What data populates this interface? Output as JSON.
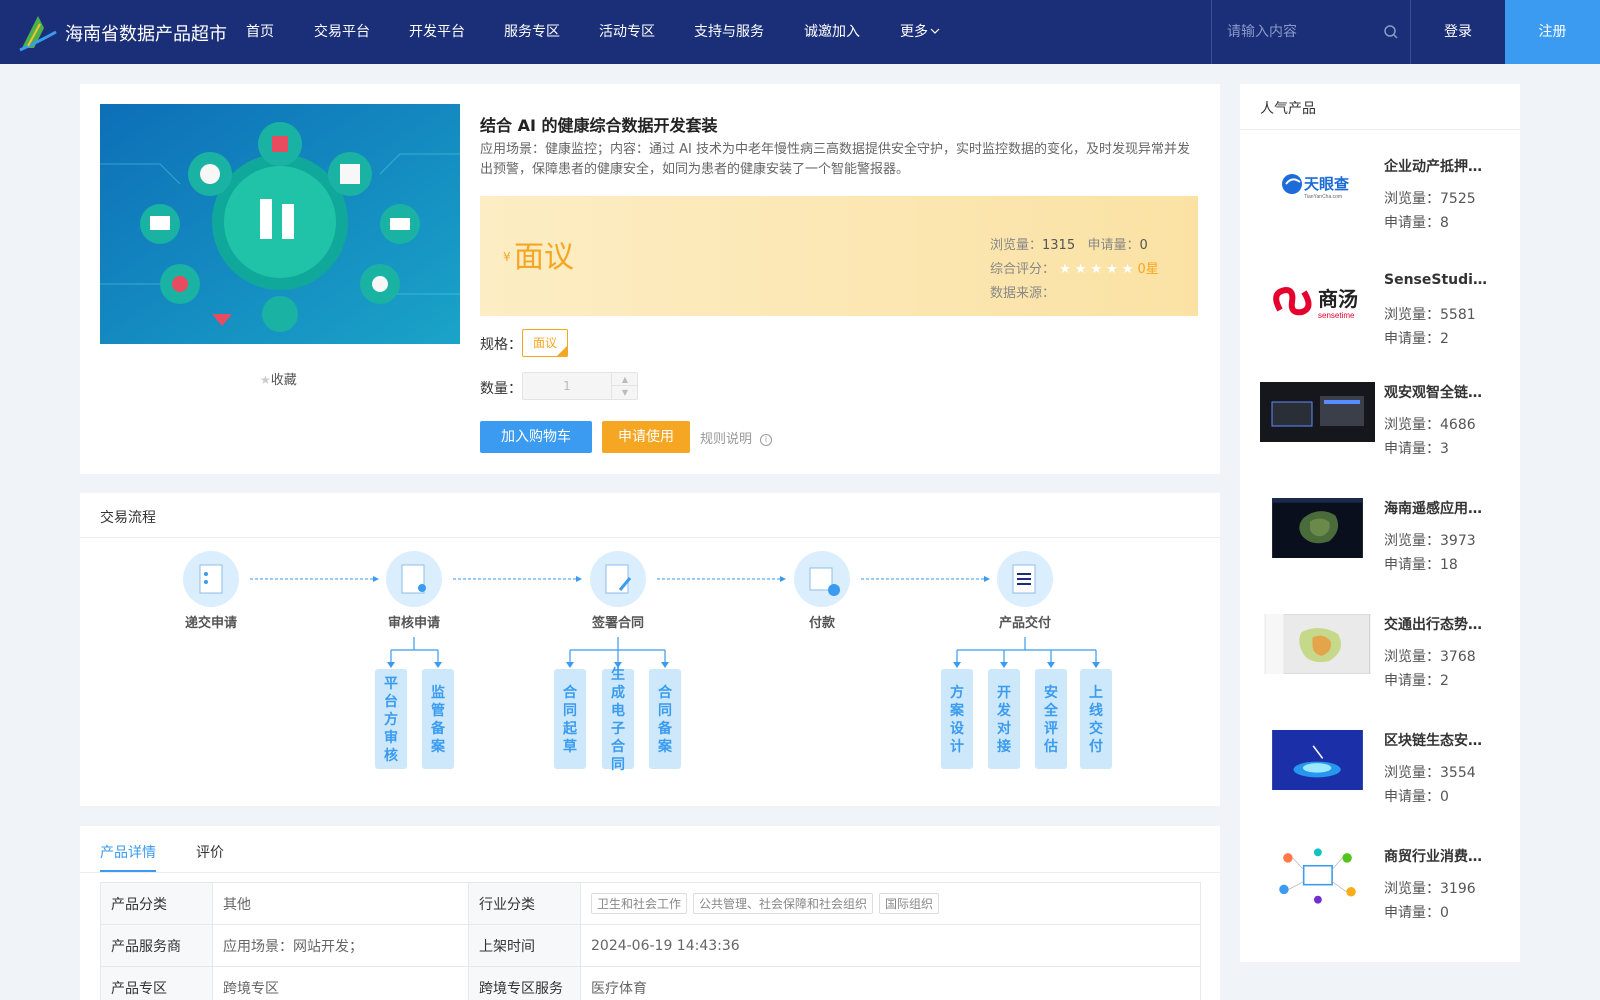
{
  "site": {
    "brand": "海南省数据产品超市",
    "nav": [
      "首页",
      "交易平台",
      "开发平台",
      "服务专区",
      "活动专区",
      "支持与服务",
      "诚邀加入",
      "更多"
    ],
    "search_placeholder": "请输入内容",
    "login": "登录",
    "register": "注册",
    "accent": "#3a9bf0",
    "header_bg": "#1b2f78",
    "price_color": "#f5a623"
  },
  "product": {
    "title": "结合 AI 的健康综合数据开发套装",
    "description": "应用场景：健康监控；内容：通过 AI 技术为中老年慢性病三高数据提供安全守护，实时监控数据的变化，及时发现异常并发出预警，保障患者的健康安全，如同为患者的健康安装了一个智能警报器。",
    "currency": "¥",
    "price": "面议",
    "views_label": "浏览量：",
    "views": "1315",
    "applications_label": "申请量：",
    "applications": "0",
    "rating_label": "综合评分：",
    "rating_stars": 0,
    "rating_text": "0星",
    "source_label": "数据来源：",
    "collect": "收藏",
    "spec_label": "规格：",
    "spec_value": "面议",
    "qty_label": "数量：",
    "qty_value": "1",
    "add_cart": "加入购物车",
    "apply": "申请使用",
    "rules": "规则说明"
  },
  "flow": {
    "title": "交易流程",
    "steps": [
      "递交申请",
      "审核申请",
      "签署合同",
      "付款",
      "产品交付"
    ],
    "sub_steps": [
      [
        "平台方审核",
        "监管备案"
      ],
      [
        "合同起草",
        "生成电子合同",
        "合同备案"
      ],
      [
        "方案设计",
        "开发对接",
        "安全评估",
        "上线交付"
      ]
    ]
  },
  "details": {
    "tabs": [
      "产品详情",
      "评价"
    ],
    "rows": [
      {
        "k1": "产品分类",
        "v1": "其他",
        "k2": "行业分类",
        "tags": [
          "卫生和社会工作",
          "公共管理、社会保障和社会组织",
          "国际组织"
        ]
      },
      {
        "k1": "产品服务商",
        "v1": "应用场景：网站开发；",
        "k2": "上架时间",
        "v2": "2024-06-19 14:43:36"
      },
      {
        "k1": "产品专区",
        "v1": "跨境专区",
        "k2": "跨境专区服务",
        "v2": "医疗体育"
      }
    ]
  },
  "popular": {
    "title": "人气产品",
    "views_label": "浏览量：",
    "apps_label": "申请量：",
    "items": [
      {
        "name": "企业动产抵押…",
        "views": "7525",
        "apps": "8",
        "logo_text": "天眼查",
        "logo_sub": "TianYanCha.com"
      },
      {
        "name": "SenseStudio…",
        "views": "5581",
        "apps": "2",
        "logo_text": "商汤",
        "logo_sub": "sensetime"
      },
      {
        "name": "观安观智全链…",
        "views": "4686",
        "apps": "3"
      },
      {
        "name": "海南遥感应用…",
        "views": "3973",
        "apps": "18"
      },
      {
        "name": "交通出行态势…",
        "views": "3768",
        "apps": "2"
      },
      {
        "name": "区块链生态安…",
        "views": "3554",
        "apps": "0"
      },
      {
        "name": "商贸行业消费…",
        "views": "3196",
        "apps": "0"
      }
    ]
  }
}
